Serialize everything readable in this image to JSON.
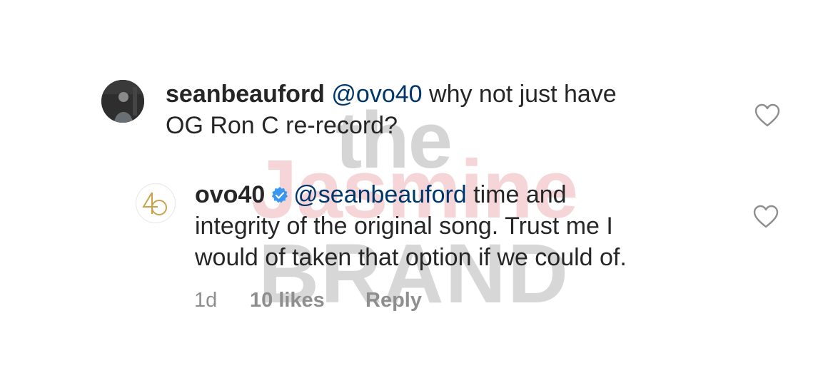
{
  "watermark": {
    "line1": "the",
    "line2": "Jasmine",
    "line3": "BRAND"
  },
  "comments": [
    {
      "username": "seanbeauford",
      "mention": "@ovo40",
      "text_line1": " why not just have",
      "text_line2": "OG Ron C re-record?"
    }
  ],
  "reply": {
    "username": "ovo40",
    "verified": true,
    "mention": "@seanbeauford",
    "text_line1": " time and",
    "text_line2": "integrity of the original song. Trust me I",
    "text_line3": "would of taken that option if we could of.",
    "time": "1d",
    "likes": "10 likes",
    "reply_label": "Reply"
  },
  "icons": {
    "like": "heart-outline-icon",
    "verified": "verified-badge-icon"
  },
  "colors": {
    "text": "#262626",
    "mention": "#00376b",
    "meta": "#8e8e8e",
    "verified": "#3897f0"
  }
}
